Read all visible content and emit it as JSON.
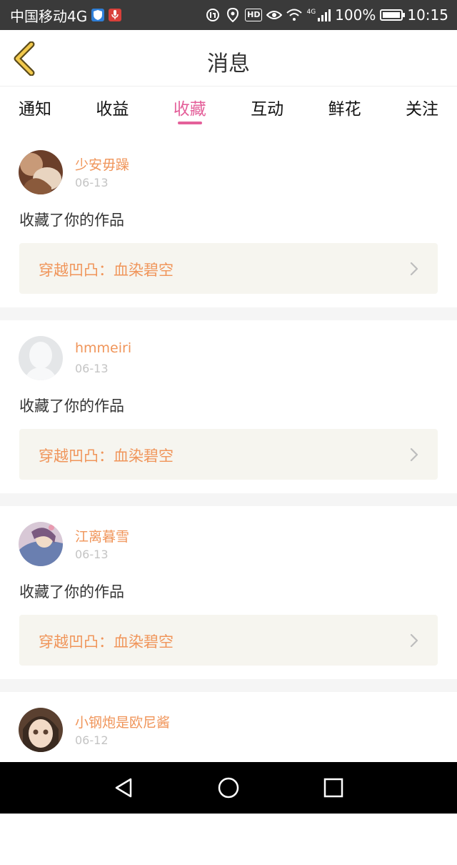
{
  "status_bar": {
    "carrier": "中国移动4G",
    "network": "4G",
    "battery": "100%",
    "time": "10:15",
    "icons": [
      "shield-badge-icon",
      "mic-badge-icon",
      "data-saver-icon",
      "location-icon",
      "hd-icon",
      "eye-icon",
      "wifi-icon",
      "signal-icon",
      "battery-icon"
    ],
    "hd_label": "HD"
  },
  "header": {
    "title": "消息",
    "accent_color": "#e4609a",
    "back_icon": "chevron-left-icon"
  },
  "tabs": [
    {
      "label": "通知",
      "active": false
    },
    {
      "label": "收益",
      "active": false
    },
    {
      "label": "收藏",
      "active": true
    },
    {
      "label": "互动",
      "active": false
    },
    {
      "label": "鲜花",
      "active": false
    },
    {
      "label": "关注",
      "active": false
    }
  ],
  "messages": [
    {
      "username": "少安毋躁",
      "date": "06-13",
      "action": "收藏了你的作品",
      "work_title": "穿越凹凸：血染碧空"
    },
    {
      "username": "hmmeiri",
      "date": "06-13",
      "action": "收藏了你的作品",
      "work_title": "穿越凹凸：血染碧空"
    },
    {
      "username": "江离暮雪",
      "date": "06-13",
      "action": "收藏了你的作品",
      "work_title": "穿越凹凸：血染碧空"
    },
    {
      "username": "小钢炮是欧尼酱",
      "date": "06-12",
      "action": "",
      "work_title": ""
    }
  ],
  "nav": {
    "icons": [
      "back-triangle-icon",
      "home-circle-icon",
      "recents-square-icon"
    ]
  }
}
